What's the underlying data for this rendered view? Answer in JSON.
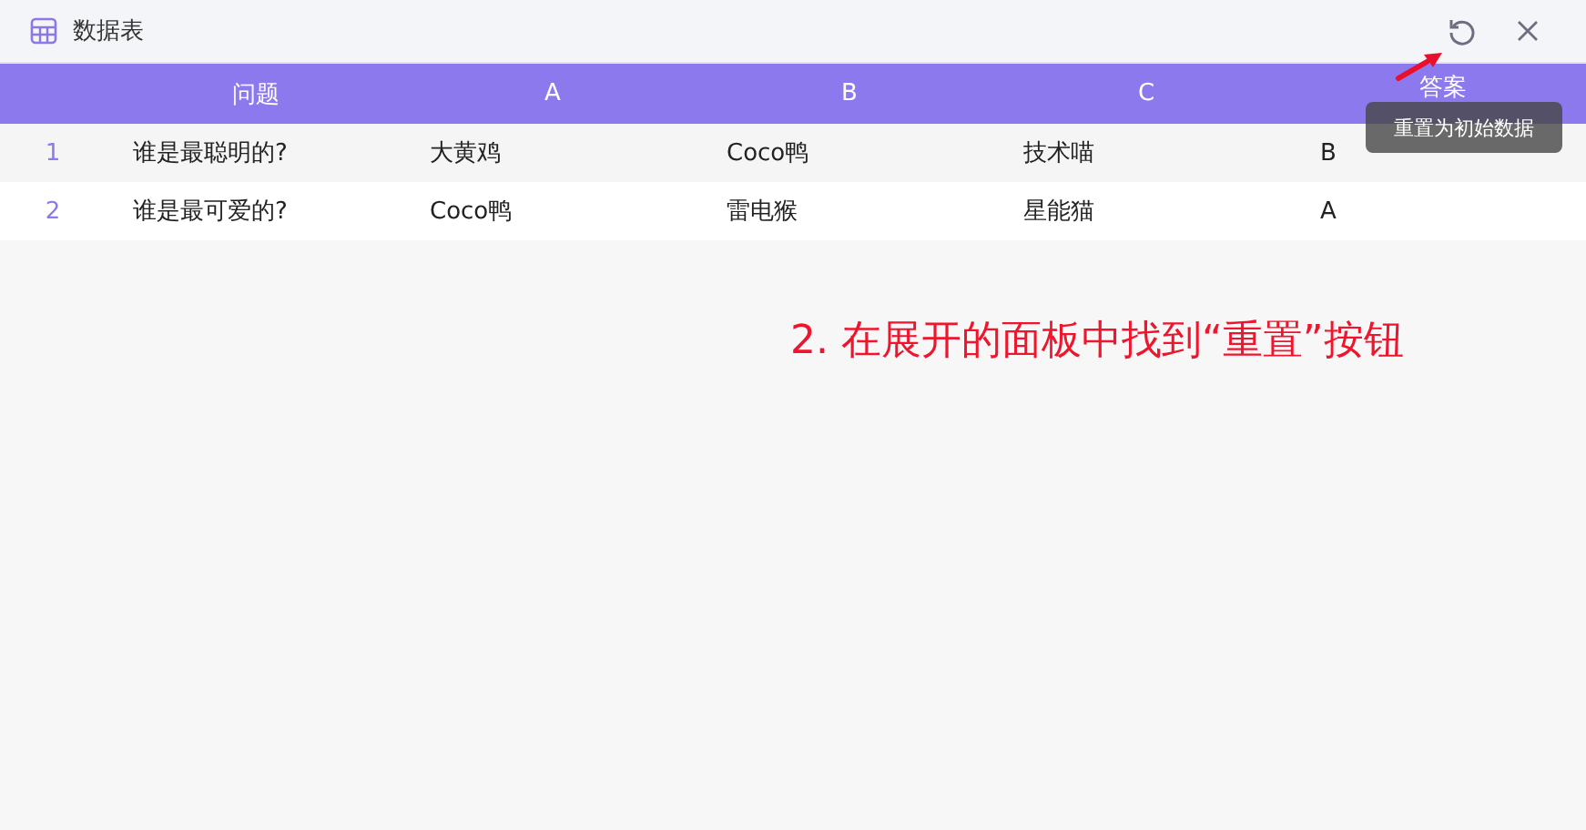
{
  "window": {
    "title": "数据表"
  },
  "tooltip": "重置为初始数据",
  "table": {
    "columns": [
      "问题",
      "A",
      "B",
      "C",
      "答案"
    ],
    "rows": [
      {
        "index": "1",
        "cells": [
          "谁是最聪明的?",
          "大黄鸡",
          "Coco鸭",
          "技术喵",
          "B"
        ]
      },
      {
        "index": "2",
        "cells": [
          "谁是最可爱的?",
          "Coco鸭",
          "雷电猴",
          "星能猫",
          "A"
        ]
      }
    ]
  },
  "annotation": "2. 在展开的面板中找到“重置”按钮"
}
